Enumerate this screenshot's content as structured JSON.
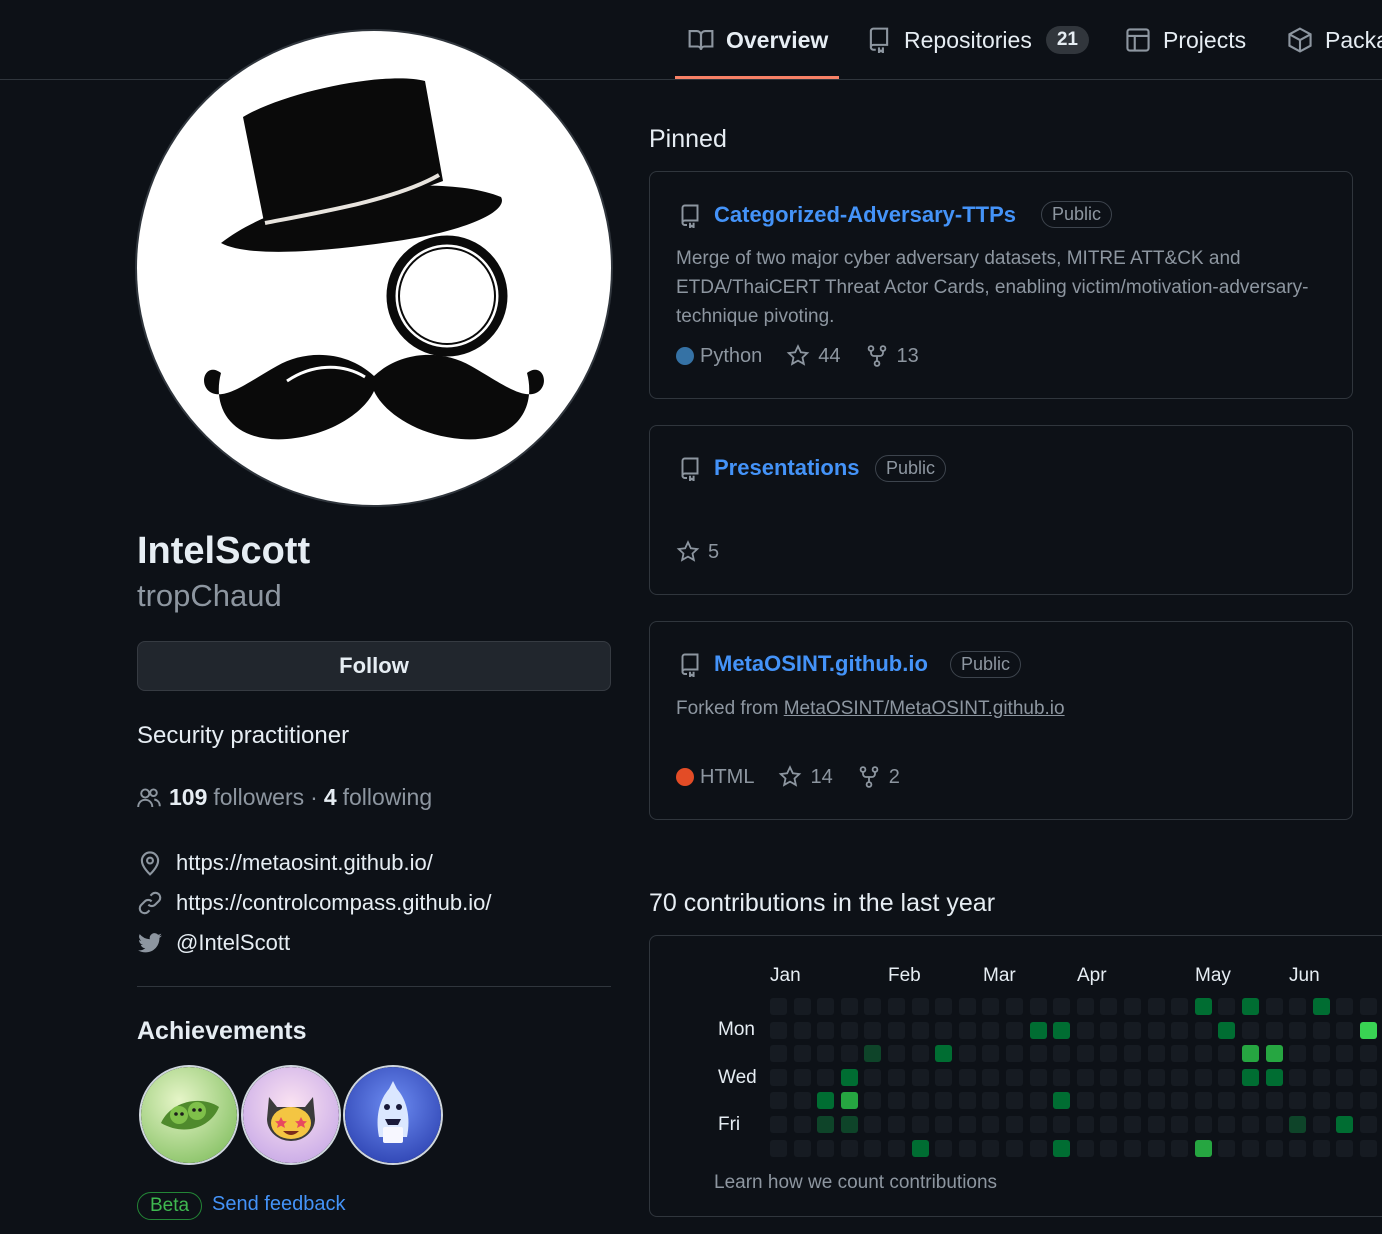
{
  "nav": {
    "tabs": [
      {
        "label": "Overview",
        "icon": "book-icon",
        "active": true
      },
      {
        "label": "Repositories",
        "icon": "repo-icon",
        "count": "21"
      },
      {
        "label": "Projects",
        "icon": "project-table-icon"
      },
      {
        "label": "Packa",
        "icon": "package-icon"
      }
    ]
  },
  "profile": {
    "display_name": "IntelScott",
    "username": "tropChaud",
    "follow_label": "Follow",
    "bio": "Security practitioner",
    "followers_count": "109",
    "followers_label": "followers",
    "separator": "·",
    "following_count": "4",
    "following_label": "following",
    "links": [
      {
        "icon": "location-icon",
        "text": "https://metaosint.github.io/"
      },
      {
        "icon": "link-icon",
        "text": "https://controlcompass.github.io/"
      },
      {
        "icon": "twitter-icon",
        "text": "@IntelScott"
      }
    ]
  },
  "achievements": {
    "title": "Achievements",
    "badges": [
      "pair-extraordinaire-badge",
      "starstruck-badge",
      "pull-shark-badge"
    ],
    "beta_label": "Beta",
    "feedback_label": "Send feedback"
  },
  "pinned": {
    "title": "Pinned",
    "repos": [
      {
        "name": "Categorized-Adversary-TTPs",
        "visibility": "Public",
        "description": "Merge of two major cyber adversary datasets, MITRE ATT&CK and ETDA/ThaiCERT Threat Actor Cards, enabling victim/motivation-adversary-technique pivoting.",
        "language": "Python",
        "language_color": "#3572A5",
        "stars": "44",
        "forks": "13"
      },
      {
        "name": "Presentations",
        "visibility": "Public",
        "stars": "5"
      },
      {
        "name": "MetaOSINT.github.io",
        "visibility": "Public",
        "forked_prefix": "Forked from ",
        "forked_from": "MetaOSINT/MetaOSINT.github.io",
        "language": "HTML",
        "language_color": "#e34c26",
        "stars": "14",
        "forks": "2"
      }
    ]
  },
  "contributions": {
    "title": "70 contributions in the last year",
    "months": [
      "Jan",
      "Feb",
      "Mar",
      "Apr",
      "May",
      "Jun"
    ],
    "day_labels": [
      "Mon",
      "Wed",
      "Fri"
    ],
    "learn_label": "Learn how we count contributions",
    "colors": {
      "empty": "#161b22",
      "l1": "#0e4429",
      "l2": "#006d32",
      "l3": "#26a641",
      "l4": "#39d353"
    },
    "levels": [
      [
        0,
        0,
        0,
        0,
        0,
        0,
        0,
        0,
        0,
        0,
        0,
        0,
        0,
        0,
        0,
        0,
        0,
        0,
        2,
        0,
        2,
        0,
        0,
        2,
        0,
        0
      ],
      [
        0,
        0,
        0,
        0,
        0,
        0,
        0,
        0,
        0,
        0,
        0,
        2,
        2,
        0,
        0,
        0,
        0,
        0,
        0,
        2,
        0,
        0,
        0,
        0,
        0,
        4
      ],
      [
        0,
        0,
        0,
        0,
        1,
        0,
        0,
        2,
        0,
        0,
        0,
        0,
        0,
        0,
        0,
        0,
        0,
        0,
        0,
        0,
        3,
        3,
        0,
        0,
        0,
        0
      ],
      [
        0,
        0,
        0,
        2,
        0,
        0,
        0,
        0,
        0,
        0,
        0,
        0,
        0,
        0,
        0,
        0,
        0,
        0,
        0,
        0,
        2,
        2,
        0,
        0,
        0,
        0
      ],
      [
        0,
        0,
        2,
        3,
        0,
        0,
        0,
        0,
        0,
        0,
        0,
        0,
        2,
        0,
        0,
        0,
        0,
        0,
        0,
        0,
        0,
        0,
        0,
        0,
        0,
        0
      ],
      [
        0,
        0,
        1,
        1,
        0,
        0,
        0,
        0,
        0,
        0,
        0,
        0,
        0,
        0,
        0,
        0,
        0,
        0,
        0,
        0,
        0,
        0,
        1,
        0,
        2,
        0
      ],
      [
        0,
        0,
        0,
        0,
        0,
        0,
        2,
        0,
        0,
        0,
        0,
        0,
        2,
        0,
        0,
        0,
        0,
        0,
        3,
        0,
        0,
        0,
        0,
        0,
        0,
        0
      ]
    ]
  }
}
